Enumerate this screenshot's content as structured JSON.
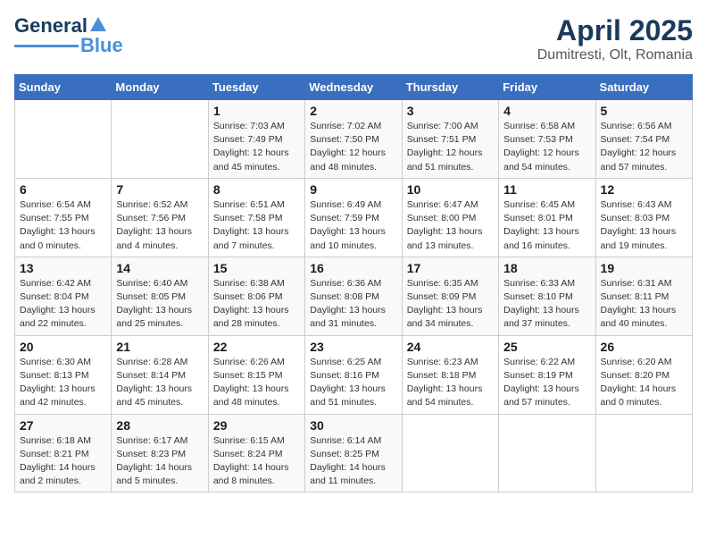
{
  "header": {
    "logo_general": "General",
    "logo_blue": "Blue",
    "title": "April 2025",
    "subtitle": "Dumitresti, Olt, Romania"
  },
  "days_of_week": [
    "Sunday",
    "Monday",
    "Tuesday",
    "Wednesday",
    "Thursday",
    "Friday",
    "Saturday"
  ],
  "weeks": [
    [
      {
        "day": "",
        "detail": ""
      },
      {
        "day": "",
        "detail": ""
      },
      {
        "day": "1",
        "detail": "Sunrise: 7:03 AM\nSunset: 7:49 PM\nDaylight: 12 hours and 45 minutes."
      },
      {
        "day": "2",
        "detail": "Sunrise: 7:02 AM\nSunset: 7:50 PM\nDaylight: 12 hours and 48 minutes."
      },
      {
        "day": "3",
        "detail": "Sunrise: 7:00 AM\nSunset: 7:51 PM\nDaylight: 12 hours and 51 minutes."
      },
      {
        "day": "4",
        "detail": "Sunrise: 6:58 AM\nSunset: 7:53 PM\nDaylight: 12 hours and 54 minutes."
      },
      {
        "day": "5",
        "detail": "Sunrise: 6:56 AM\nSunset: 7:54 PM\nDaylight: 12 hours and 57 minutes."
      }
    ],
    [
      {
        "day": "6",
        "detail": "Sunrise: 6:54 AM\nSunset: 7:55 PM\nDaylight: 13 hours and 0 minutes."
      },
      {
        "day": "7",
        "detail": "Sunrise: 6:52 AM\nSunset: 7:56 PM\nDaylight: 13 hours and 4 minutes."
      },
      {
        "day": "8",
        "detail": "Sunrise: 6:51 AM\nSunset: 7:58 PM\nDaylight: 13 hours and 7 minutes."
      },
      {
        "day": "9",
        "detail": "Sunrise: 6:49 AM\nSunset: 7:59 PM\nDaylight: 13 hours and 10 minutes."
      },
      {
        "day": "10",
        "detail": "Sunrise: 6:47 AM\nSunset: 8:00 PM\nDaylight: 13 hours and 13 minutes."
      },
      {
        "day": "11",
        "detail": "Sunrise: 6:45 AM\nSunset: 8:01 PM\nDaylight: 13 hours and 16 minutes."
      },
      {
        "day": "12",
        "detail": "Sunrise: 6:43 AM\nSunset: 8:03 PM\nDaylight: 13 hours and 19 minutes."
      }
    ],
    [
      {
        "day": "13",
        "detail": "Sunrise: 6:42 AM\nSunset: 8:04 PM\nDaylight: 13 hours and 22 minutes."
      },
      {
        "day": "14",
        "detail": "Sunrise: 6:40 AM\nSunset: 8:05 PM\nDaylight: 13 hours and 25 minutes."
      },
      {
        "day": "15",
        "detail": "Sunrise: 6:38 AM\nSunset: 8:06 PM\nDaylight: 13 hours and 28 minutes."
      },
      {
        "day": "16",
        "detail": "Sunrise: 6:36 AM\nSunset: 8:08 PM\nDaylight: 13 hours and 31 minutes."
      },
      {
        "day": "17",
        "detail": "Sunrise: 6:35 AM\nSunset: 8:09 PM\nDaylight: 13 hours and 34 minutes."
      },
      {
        "day": "18",
        "detail": "Sunrise: 6:33 AM\nSunset: 8:10 PM\nDaylight: 13 hours and 37 minutes."
      },
      {
        "day": "19",
        "detail": "Sunrise: 6:31 AM\nSunset: 8:11 PM\nDaylight: 13 hours and 40 minutes."
      }
    ],
    [
      {
        "day": "20",
        "detail": "Sunrise: 6:30 AM\nSunset: 8:13 PM\nDaylight: 13 hours and 42 minutes."
      },
      {
        "day": "21",
        "detail": "Sunrise: 6:28 AM\nSunset: 8:14 PM\nDaylight: 13 hours and 45 minutes."
      },
      {
        "day": "22",
        "detail": "Sunrise: 6:26 AM\nSunset: 8:15 PM\nDaylight: 13 hours and 48 minutes."
      },
      {
        "day": "23",
        "detail": "Sunrise: 6:25 AM\nSunset: 8:16 PM\nDaylight: 13 hours and 51 minutes."
      },
      {
        "day": "24",
        "detail": "Sunrise: 6:23 AM\nSunset: 8:18 PM\nDaylight: 13 hours and 54 minutes."
      },
      {
        "day": "25",
        "detail": "Sunrise: 6:22 AM\nSunset: 8:19 PM\nDaylight: 13 hours and 57 minutes."
      },
      {
        "day": "26",
        "detail": "Sunrise: 6:20 AM\nSunset: 8:20 PM\nDaylight: 14 hours and 0 minutes."
      }
    ],
    [
      {
        "day": "27",
        "detail": "Sunrise: 6:18 AM\nSunset: 8:21 PM\nDaylight: 14 hours and 2 minutes."
      },
      {
        "day": "28",
        "detail": "Sunrise: 6:17 AM\nSunset: 8:23 PM\nDaylight: 14 hours and 5 minutes."
      },
      {
        "day": "29",
        "detail": "Sunrise: 6:15 AM\nSunset: 8:24 PM\nDaylight: 14 hours and 8 minutes."
      },
      {
        "day": "30",
        "detail": "Sunrise: 6:14 AM\nSunset: 8:25 PM\nDaylight: 14 hours and 11 minutes."
      },
      {
        "day": "",
        "detail": ""
      },
      {
        "day": "",
        "detail": ""
      },
      {
        "day": "",
        "detail": ""
      }
    ]
  ]
}
